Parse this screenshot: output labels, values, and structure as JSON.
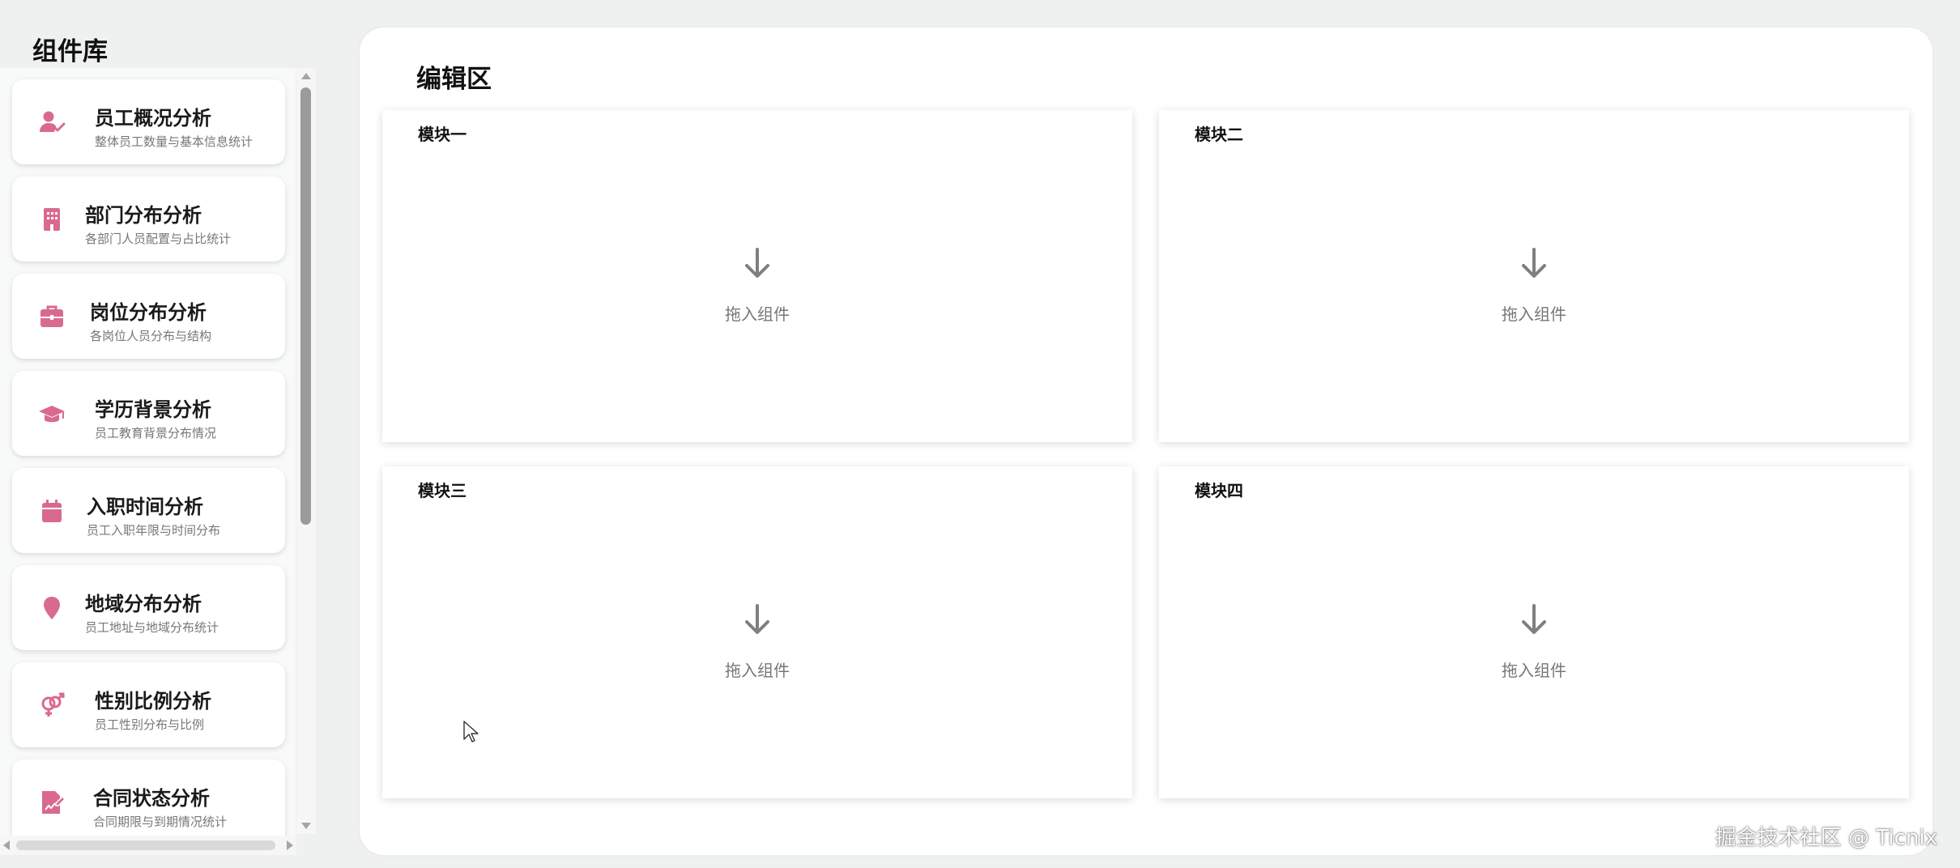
{
  "sidebar": {
    "title": "组件库",
    "accent_color": "#d96a8e",
    "items": [
      {
        "title": "员工概况分析",
        "desc": "整体员工数量与基本信息统计",
        "icon": "user-check-icon"
      },
      {
        "title": "部门分布分析",
        "desc": "各部门人员配置与占比统计",
        "icon": "building-icon"
      },
      {
        "title": "岗位分布分析",
        "desc": "各岗位人员分布与结构",
        "icon": "briefcase-icon"
      },
      {
        "title": "学历背景分析",
        "desc": "员工教育背景分布情况",
        "icon": "graduation-cap-icon"
      },
      {
        "title": "入职时间分析",
        "desc": "员工入职年限与时间分布",
        "icon": "calendar-icon"
      },
      {
        "title": "地域分布分析",
        "desc": "员工地址与地域分布统计",
        "icon": "location-pin-icon"
      },
      {
        "title": "性别比例分析",
        "desc": "员工性别分布与比例",
        "icon": "gender-icon"
      },
      {
        "title": "合同状态分析",
        "desc": "合同期限与到期情况统计",
        "icon": "contract-edit-icon"
      }
    ]
  },
  "editor": {
    "title": "编辑区",
    "drop_label": "拖入组件",
    "modules": [
      {
        "title": "模块一"
      },
      {
        "title": "模块二"
      },
      {
        "title": "模块三"
      },
      {
        "title": "模块四"
      }
    ]
  },
  "watermark": "掘金技术社区 @ Ticnix"
}
